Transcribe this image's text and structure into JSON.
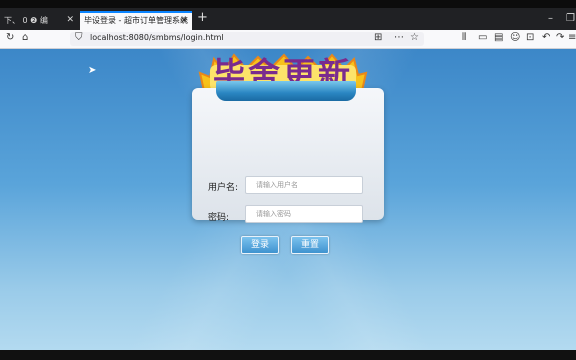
{
  "browser": {
    "tabs": [
      {
        "label": "下、 0 ❷ 编"
      },
      {
        "label": "毕设登录 - 超市订单管理系统"
      }
    ],
    "new_tab": "+",
    "url": "localhost:8080/smbms/login.html",
    "window_controls": {
      "minimize": "–",
      "restore": "❐"
    },
    "colors": {
      "active_tab_accent": "#0a84ff"
    }
  },
  "page": {
    "logo_text": "毕舍更新",
    "system_title": "超市订单管理系统",
    "form": {
      "username_label": "用户名:",
      "username_placeholder": "请输入用户名",
      "password_label": "密码:",
      "password_placeholder": "请输入密码",
      "login_button": "登录",
      "reset_button": "重置"
    }
  }
}
